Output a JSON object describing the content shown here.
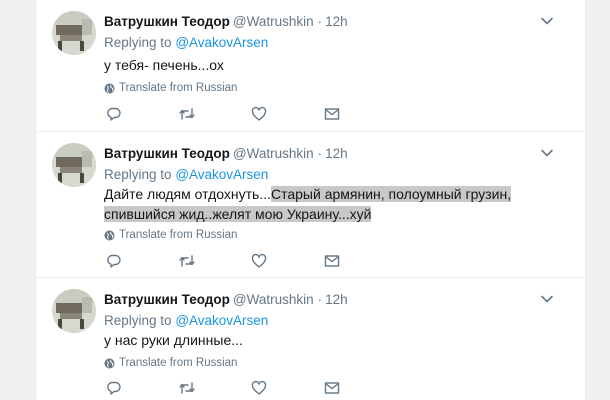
{
  "tweets": [
    {
      "name": "Ватрушкин Теодор",
      "handle": "@Watrushkin",
      "dot": "·",
      "time": "12h",
      "replying_prefix": "Replying to",
      "replying_to": "@AvakovArsen",
      "text_plain": "у тебя- печень...ох",
      "text_highlight": "",
      "text_tail": "",
      "translate": "Translate from Russian"
    },
    {
      "name": "Ватрушкин Теодор",
      "handle": "@Watrushkin",
      "dot": "·",
      "time": "12h",
      "replying_prefix": "Replying to",
      "replying_to": "@AvakovArsen",
      "text_plain": "Дайте людям отдохнуть...",
      "text_highlight": "Старый армянин, полоумный грузин,  спившийся жид..желят мою Украину...хуй",
      "text_tail": "",
      "translate": "Translate from Russian"
    },
    {
      "name": "Ватрушкин Теодор",
      "handle": "@Watrushkin",
      "dot": "·",
      "time": "12h",
      "replying_prefix": "Replying to",
      "replying_to": "@AvakovArsen",
      "text_plain": "у нас руки длинные...",
      "text_highlight": "",
      "text_tail": "",
      "translate": "Translate from Russian"
    }
  ],
  "icons": {
    "globe": "globe-icon",
    "reply": "reply-icon",
    "retweet": "retweet-icon",
    "like": "heart-icon",
    "message": "envelope-icon",
    "caret": "chevron-down-icon"
  },
  "colors": {
    "link": "#1b95e0",
    "muted": "#657786",
    "text": "#14171a",
    "highlight": "#c8c8c8"
  }
}
